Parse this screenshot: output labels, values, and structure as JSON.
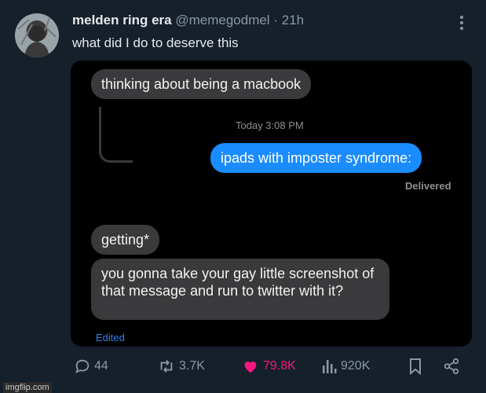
{
  "tweet": {
    "display_name": "melden ring era",
    "handle": "@memegodmel",
    "separator": "·",
    "time": "21h",
    "text": "what did I do to deserve this"
  },
  "screenshot": {
    "messages": [
      {
        "text": "thinking about being a macbook",
        "side": "left"
      },
      {
        "text": "ipads with imposter syndrome:",
        "side": "right"
      },
      {
        "text": "getting*",
        "side": "left"
      },
      {
        "text": "you gonna take your gay little screenshot of that message and run to twitter with it?",
        "side": "left"
      }
    ],
    "timestamp": "Today 3:08 PM",
    "delivered": "Delivered",
    "edited": "Edited"
  },
  "actions": {
    "replies": "44",
    "reposts": "3.7K",
    "likes": "79.8K",
    "views": "920K"
  },
  "watermark": "imgflip.com",
  "colors": {
    "background": "#15202b",
    "accent_like": "#f91880",
    "imessage_blue": "#1a8cff",
    "imessage_gray": "#3a3a3c"
  }
}
